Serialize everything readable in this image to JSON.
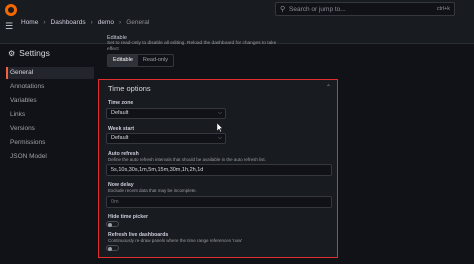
{
  "topbar": {
    "search_text": "Search or jump to...",
    "search_shortcut": "ctrl+k"
  },
  "breadcrumb": [
    "Home",
    "Dashboards",
    "demo",
    "General"
  ],
  "sidebar": {
    "title": "Settings",
    "items": [
      {
        "label": "General",
        "active": true
      },
      {
        "label": "Annotations",
        "active": false
      },
      {
        "label": "Variables",
        "active": false
      },
      {
        "label": "Links",
        "active": false
      },
      {
        "label": "Versions",
        "active": false
      },
      {
        "label": "Permissions",
        "active": false
      },
      {
        "label": "JSON Model",
        "active": false
      }
    ]
  },
  "editable": {
    "intro": "Set to read-only to disable all editing. Reload the dashboard for changes to take",
    "intro2": "effect",
    "label": "Editable",
    "options": [
      "Editable",
      "Read-only"
    ],
    "selected": "Editable"
  },
  "time_options": {
    "title": "Time options",
    "time_zone": {
      "label": "Time zone",
      "value": "Default"
    },
    "week_start": {
      "label": "Week start",
      "value": "Default"
    },
    "auto_refresh": {
      "label": "Auto refresh",
      "description": "Define the auto refresh intervals that should be available in the auto refresh list.",
      "value": "5s,10s,30s,1m,5m,15m,30m,1h,2h,1d"
    },
    "now_delay": {
      "label": "Now delay",
      "description": "Exclude recent data that may be incomplete.",
      "placeholder": "0m"
    },
    "hide_time_picker": {
      "label": "Hide time picker",
      "value": false
    },
    "refresh_live": {
      "label": "Refresh live dashboards",
      "description": "Continuously re-draw panels where the time range references 'now'",
      "value": false
    }
  },
  "colors": {
    "accent": "#f55f3e",
    "highlight_border": "#e02f2f",
    "logo": "#f46800"
  }
}
